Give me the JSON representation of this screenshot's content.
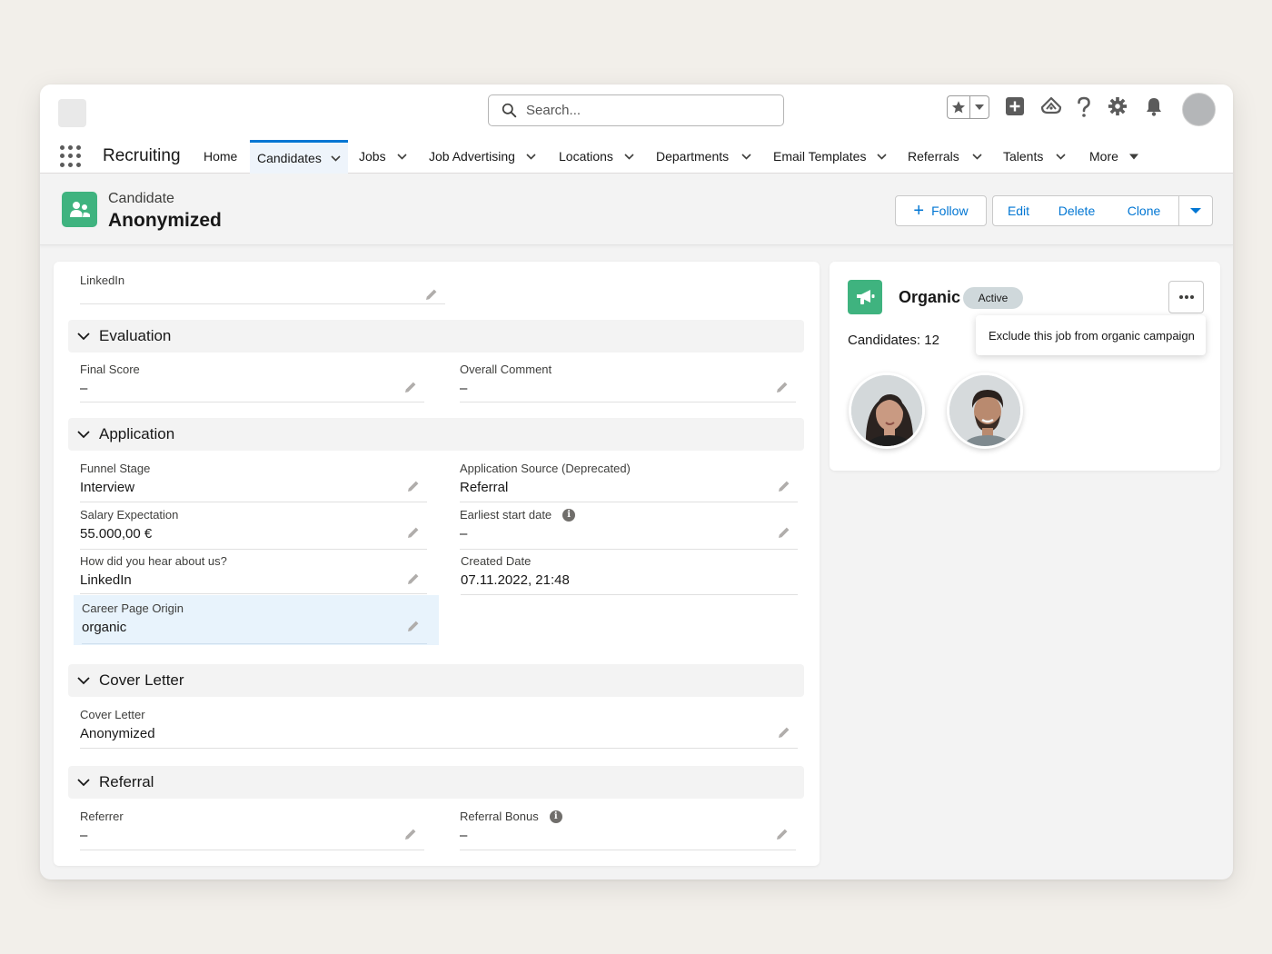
{
  "header": {
    "search_placeholder": "Search...",
    "app_name": "Recruiting"
  },
  "nav": {
    "items": [
      {
        "label": "Home",
        "dropdown": false
      },
      {
        "label": "Candidates",
        "dropdown": true,
        "active": true
      },
      {
        "label": "Jobs",
        "dropdown": true
      },
      {
        "label": "Job Advertising",
        "dropdown": true
      },
      {
        "label": "Locations",
        "dropdown": true
      },
      {
        "label": "Departments",
        "dropdown": true
      },
      {
        "label": "Email Templates",
        "dropdown": true
      },
      {
        "label": "Referrals",
        "dropdown": true
      },
      {
        "label": "Talents",
        "dropdown": true
      },
      {
        "label": "More",
        "dropdown": true
      }
    ]
  },
  "record": {
    "type": "Candidate",
    "name": "Anonymized",
    "buttons": {
      "follow": "Follow",
      "edit": "Edit",
      "delete": "Delete",
      "clone": "Clone"
    }
  },
  "details": {
    "linkedin": {
      "label": "LinkedIn",
      "value": ""
    },
    "sections": {
      "evaluation": "Evaluation",
      "application": "Application",
      "cover_letter": "Cover Letter",
      "referral": "Referral"
    },
    "fields": {
      "final_score": {
        "label": "Final Score",
        "value": "–"
      },
      "overall_comment": {
        "label": "Overall Comment",
        "value": "–"
      },
      "funnel_stage": {
        "label": "Funnel Stage",
        "value": "Interview"
      },
      "application_source": {
        "label": "Application Source (Deprecated)",
        "value": "Referral"
      },
      "salary_expectation": {
        "label": "Salary Expectation",
        "value": "55.000,00 €"
      },
      "earliest_start_date": {
        "label": "Earliest start date",
        "value": "–"
      },
      "how_did_you_hear": {
        "label": "How did you hear about us?",
        "value": "LinkedIn"
      },
      "created_date": {
        "label": "Created Date",
        "value": "07.11.2022, 21:48"
      },
      "career_page_origin": {
        "label": "Career Page Origin",
        "value": "organic"
      },
      "cover_letter": {
        "label": "Cover Letter",
        "value": "Anonymized"
      },
      "referrer": {
        "label": "Referrer",
        "value": "–"
      },
      "referral_bonus": {
        "label": "Referral Bonus",
        "value": "–"
      }
    }
  },
  "campaign": {
    "name": "Organic",
    "status": "Active",
    "candidates_text": "Candidates:  12",
    "menu_item": "Exclude this job from organic campaign"
  },
  "colors": {
    "brand_blue": "#0176d3",
    "record_green": "#3fb37f",
    "highlight_bg": "#e8f3fc"
  },
  "icons": [
    "search-icon",
    "star-icon",
    "add-icon",
    "trailhead-icon",
    "help-icon",
    "gear-icon",
    "bell-icon",
    "app-launcher-icon",
    "candidate-icon",
    "megaphone-icon",
    "pencil-icon",
    "info-icon",
    "chevron-down-icon",
    "more-dots-icon"
  ]
}
